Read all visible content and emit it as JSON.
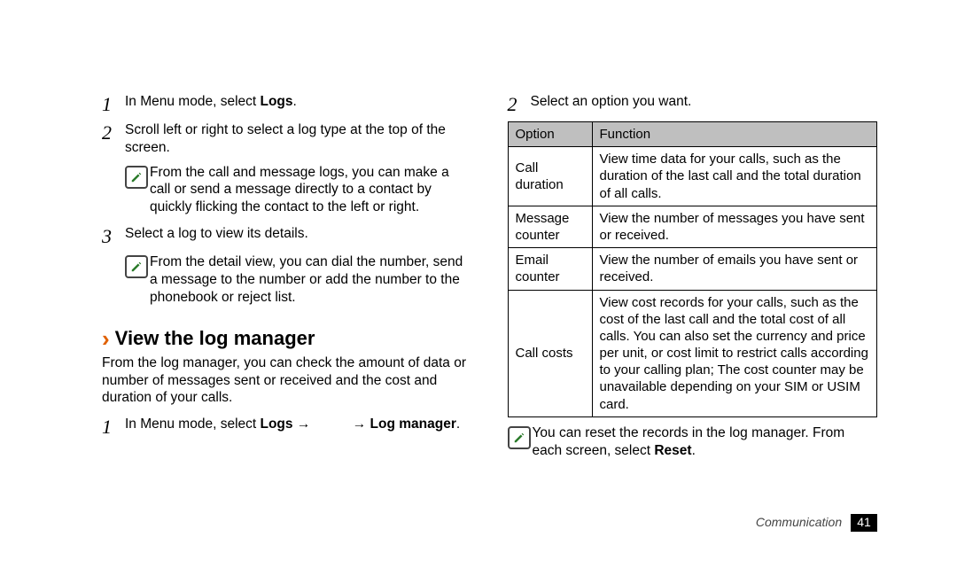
{
  "left": {
    "step1": {
      "num": "1",
      "pre": "In Menu mode, select ",
      "bold": "Logs",
      "post": "."
    },
    "step2": {
      "num": "2",
      "text": "Scroll left or right to select a log type at the top of the screen."
    },
    "note1": "From the call and message logs, you can make a call or send a message directly to a contact by quickly flicking the contact to the left or right.",
    "step3": {
      "num": "3",
      "text": "Select a log to view its details."
    },
    "note2": "From the detail view, you can dial the number, send a message to the number or add the number to the phonebook or reject list.",
    "section": {
      "title": "View the log manager",
      "intro": "From the log manager, you can check the amount of data or number of messages sent or received and the cost and duration of your calls.",
      "step1": {
        "num": "1",
        "pre": "In Menu mode, select ",
        "bold1": "Logs",
        "mid": " → ",
        "gap": "          ",
        "arrow2": "→ ",
        "bold2": "Log manager",
        "post": "."
      }
    }
  },
  "right": {
    "step2": {
      "num": "2",
      "text": "Select an option you want."
    },
    "table": {
      "head": {
        "option": "Option",
        "function": "Function"
      },
      "rows": [
        {
          "option": "Call duration",
          "function": "View time data for your calls, such as the duration of the last call and the total duration of all calls."
        },
        {
          "option": "Message counter",
          "function": "View the number of messages you have sent or received."
        },
        {
          "option": "Email counter",
          "function": "View the number of emails you have sent or received."
        },
        {
          "option": "Call costs",
          "function": "View cost records for your calls, such as the cost of the last call and the total cost of all calls. You can also set the currency and price per unit, or cost limit to restrict calls according to your calling plan; The cost counter may be unavailable depending on your SIM or USIM card."
        }
      ]
    },
    "note": {
      "pre": "You can reset the records in the log manager. From each screen, select ",
      "bold": "Reset",
      "post": "."
    }
  },
  "footer": {
    "label": "Communication",
    "page": "41"
  }
}
